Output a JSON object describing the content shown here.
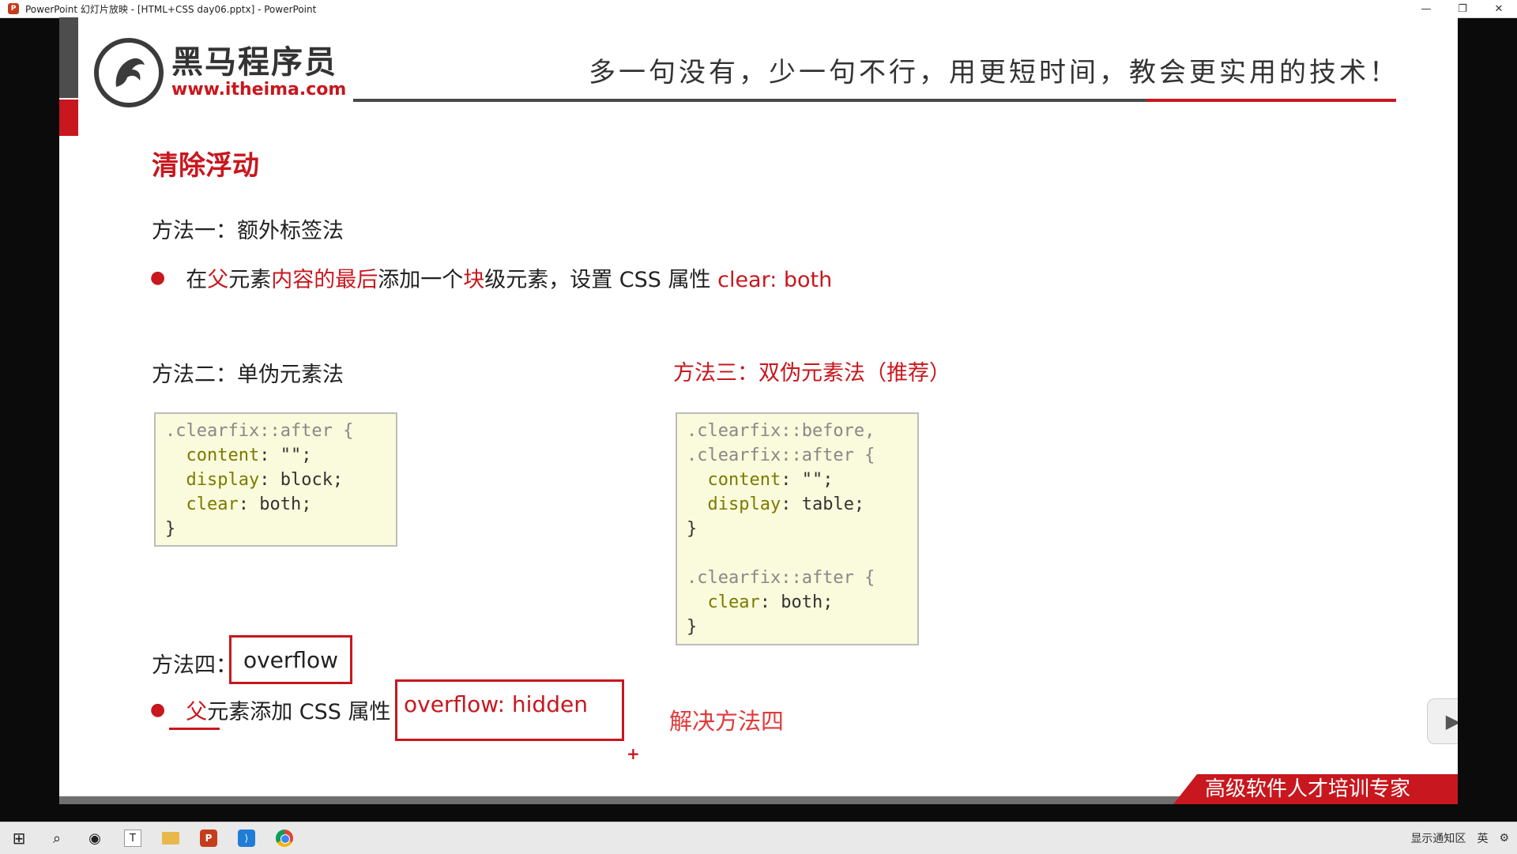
{
  "window": {
    "title": "PowerPoint 幻灯片放映 - [HTML+CSS day06.pptx] - PowerPoint",
    "min": "—",
    "restore": "❐",
    "close": "✕"
  },
  "slide": {
    "logo_cn": "黑马程序员",
    "logo_url": "www.itheima.com",
    "slogan": "多一句没有，少一句不行，用更短时间，教会更实用的技术！",
    "heading": "清除浮动",
    "method1": {
      "title": "方法一：额外标签法",
      "bullet": [
        "在",
        "父",
        "元素",
        "内容的最后",
        "添加一个",
        "块",
        "级元素，设置 CSS 属性 ",
        "clear: both"
      ]
    },
    "method2": {
      "title": "方法二：单伪元素法",
      "code": [
        {
          "sel": ".clearfix::after {"
        },
        {
          "prop": "content",
          "val": ": \"\";"
        },
        {
          "prop": "display",
          "val": ": block;"
        },
        {
          "prop": "clear",
          "val": ": both;"
        },
        {
          "close": "}"
        }
      ]
    },
    "method3": {
      "title": "方法三：双伪元素法（推荐）",
      "code": [
        {
          "sel": ".clearfix::before,"
        },
        {
          "sel": ".clearfix::after {"
        },
        {
          "prop": "content",
          "val": ": \"\";"
        },
        {
          "prop": "display",
          "val": ": table;"
        },
        {
          "close": "}"
        },
        {
          "blank": ""
        },
        {
          "sel": ".clearfix::after {"
        },
        {
          "prop": "clear",
          "val": ": both;"
        },
        {
          "close": "}"
        }
      ]
    },
    "method4": {
      "title": "方法四：",
      "boxed": "overflow",
      "bullet_fu": "父",
      "bullet_rest": "元素添加 CSS 属性",
      "boxed_prop": "overflow: hidden",
      "annotation": "解决方法四",
      "plus": "+"
    },
    "footer": "高级软件人才培训专家",
    "play_icon": "▶"
  },
  "taskbar": {
    "tray_lang": "英",
    "tray_text": "显示通知区"
  }
}
